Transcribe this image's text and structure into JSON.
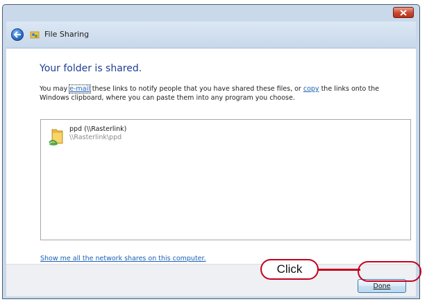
{
  "window": {
    "title": "File Sharing",
    "close_icon": "close-icon",
    "back_icon": "back-arrow-icon",
    "app_icon": "file-sharing-icon"
  },
  "content": {
    "heading": "Your folder is shared.",
    "desc_before_email": "You may ",
    "email_link": "e-mail",
    "desc_between_links": " these links to notify people that you have shared these files, or ",
    "copy_link": "copy",
    "desc_after_copy": " the links onto the Windows clipboard, where you can paste them into any program you choose.",
    "shares": [
      {
        "name": "ppd (\\\\Rasterlink)",
        "path": "\\\\Rasterlink\\ppd",
        "icon": "shared-folder-icon"
      }
    ],
    "network_shares_link": "Show me all the network shares on this computer."
  },
  "footer": {
    "done_label": "Done"
  },
  "annotation": {
    "callout_label": "Click",
    "color": "#c4001d"
  }
}
